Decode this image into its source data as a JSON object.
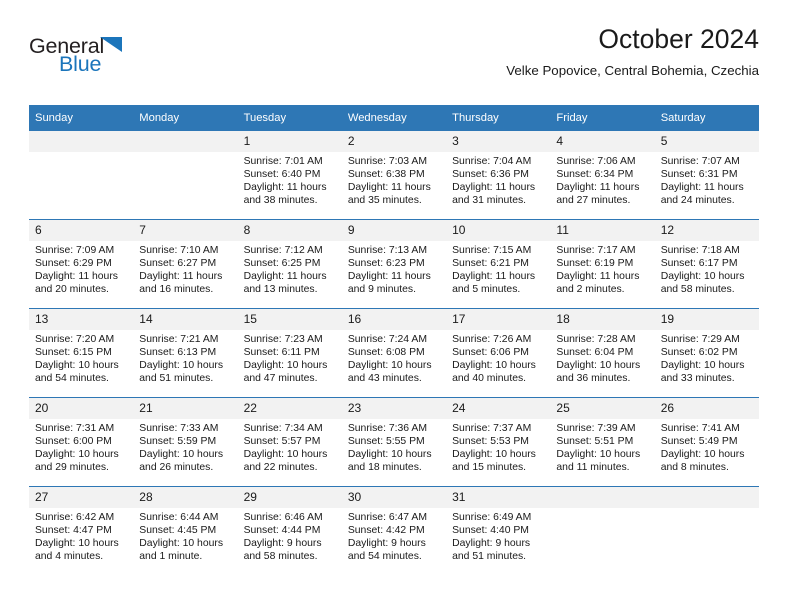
{
  "logo": {
    "text_primary": "General",
    "text_secondary": "Blue",
    "color_primary": "#231f20",
    "color_secondary": "#1b75bb",
    "triangle_icon": "triangle-icon"
  },
  "header": {
    "title": "October 2024",
    "subtitle": "Velke Popovice, Central Bohemia, Czechia"
  },
  "theme": {
    "header_blue": "#2e77b5",
    "daynum_gray": "#f2f2f2",
    "text": "#1a1a1a"
  },
  "calendar": {
    "weekday_headers": [
      "Sunday",
      "Monday",
      "Tuesday",
      "Wednesday",
      "Thursday",
      "Friday",
      "Saturday"
    ],
    "weeks": [
      [
        {
          "day": "",
          "blank": true
        },
        {
          "day": "",
          "blank": true
        },
        {
          "day": "1",
          "sunrise": "Sunrise: 7:01 AM",
          "sunset": "Sunset: 6:40 PM",
          "daylight": "Daylight: 11 hours and 38 minutes."
        },
        {
          "day": "2",
          "sunrise": "Sunrise: 7:03 AM",
          "sunset": "Sunset: 6:38 PM",
          "daylight": "Daylight: 11 hours and 35 minutes."
        },
        {
          "day": "3",
          "sunrise": "Sunrise: 7:04 AM",
          "sunset": "Sunset: 6:36 PM",
          "daylight": "Daylight: 11 hours and 31 minutes."
        },
        {
          "day": "4",
          "sunrise": "Sunrise: 7:06 AM",
          "sunset": "Sunset: 6:34 PM",
          "daylight": "Daylight: 11 hours and 27 minutes."
        },
        {
          "day": "5",
          "sunrise": "Sunrise: 7:07 AM",
          "sunset": "Sunset: 6:31 PM",
          "daylight": "Daylight: 11 hours and 24 minutes."
        }
      ],
      [
        {
          "day": "6",
          "sunrise": "Sunrise: 7:09 AM",
          "sunset": "Sunset: 6:29 PM",
          "daylight": "Daylight: 11 hours and 20 minutes."
        },
        {
          "day": "7",
          "sunrise": "Sunrise: 7:10 AM",
          "sunset": "Sunset: 6:27 PM",
          "daylight": "Daylight: 11 hours and 16 minutes."
        },
        {
          "day": "8",
          "sunrise": "Sunrise: 7:12 AM",
          "sunset": "Sunset: 6:25 PM",
          "daylight": "Daylight: 11 hours and 13 minutes."
        },
        {
          "day": "9",
          "sunrise": "Sunrise: 7:13 AM",
          "sunset": "Sunset: 6:23 PM",
          "daylight": "Daylight: 11 hours and 9 minutes."
        },
        {
          "day": "10",
          "sunrise": "Sunrise: 7:15 AM",
          "sunset": "Sunset: 6:21 PM",
          "daylight": "Daylight: 11 hours and 5 minutes."
        },
        {
          "day": "11",
          "sunrise": "Sunrise: 7:17 AM",
          "sunset": "Sunset: 6:19 PM",
          "daylight": "Daylight: 11 hours and 2 minutes."
        },
        {
          "day": "12",
          "sunrise": "Sunrise: 7:18 AM",
          "sunset": "Sunset: 6:17 PM",
          "daylight": "Daylight: 10 hours and 58 minutes."
        }
      ],
      [
        {
          "day": "13",
          "sunrise": "Sunrise: 7:20 AM",
          "sunset": "Sunset: 6:15 PM",
          "daylight": "Daylight: 10 hours and 54 minutes."
        },
        {
          "day": "14",
          "sunrise": "Sunrise: 7:21 AM",
          "sunset": "Sunset: 6:13 PM",
          "daylight": "Daylight: 10 hours and 51 minutes."
        },
        {
          "day": "15",
          "sunrise": "Sunrise: 7:23 AM",
          "sunset": "Sunset: 6:11 PM",
          "daylight": "Daylight: 10 hours and 47 minutes."
        },
        {
          "day": "16",
          "sunrise": "Sunrise: 7:24 AM",
          "sunset": "Sunset: 6:08 PM",
          "daylight": "Daylight: 10 hours and 43 minutes."
        },
        {
          "day": "17",
          "sunrise": "Sunrise: 7:26 AM",
          "sunset": "Sunset: 6:06 PM",
          "daylight": "Daylight: 10 hours and 40 minutes."
        },
        {
          "day": "18",
          "sunrise": "Sunrise: 7:28 AM",
          "sunset": "Sunset: 6:04 PM",
          "daylight": "Daylight: 10 hours and 36 minutes."
        },
        {
          "day": "19",
          "sunrise": "Sunrise: 7:29 AM",
          "sunset": "Sunset: 6:02 PM",
          "daylight": "Daylight: 10 hours and 33 minutes."
        }
      ],
      [
        {
          "day": "20",
          "sunrise": "Sunrise: 7:31 AM",
          "sunset": "Sunset: 6:00 PM",
          "daylight": "Daylight: 10 hours and 29 minutes."
        },
        {
          "day": "21",
          "sunrise": "Sunrise: 7:33 AM",
          "sunset": "Sunset: 5:59 PM",
          "daylight": "Daylight: 10 hours and 26 minutes."
        },
        {
          "day": "22",
          "sunrise": "Sunrise: 7:34 AM",
          "sunset": "Sunset: 5:57 PM",
          "daylight": "Daylight: 10 hours and 22 minutes."
        },
        {
          "day": "23",
          "sunrise": "Sunrise: 7:36 AM",
          "sunset": "Sunset: 5:55 PM",
          "daylight": "Daylight: 10 hours and 18 minutes."
        },
        {
          "day": "24",
          "sunrise": "Sunrise: 7:37 AM",
          "sunset": "Sunset: 5:53 PM",
          "daylight": "Daylight: 10 hours and 15 minutes."
        },
        {
          "day": "25",
          "sunrise": "Sunrise: 7:39 AM",
          "sunset": "Sunset: 5:51 PM",
          "daylight": "Daylight: 10 hours and 11 minutes."
        },
        {
          "day": "26",
          "sunrise": "Sunrise: 7:41 AM",
          "sunset": "Sunset: 5:49 PM",
          "daylight": "Daylight: 10 hours and 8 minutes."
        }
      ],
      [
        {
          "day": "27",
          "sunrise": "Sunrise: 6:42 AM",
          "sunset": "Sunset: 4:47 PM",
          "daylight": "Daylight: 10 hours and 4 minutes."
        },
        {
          "day": "28",
          "sunrise": "Sunrise: 6:44 AM",
          "sunset": "Sunset: 4:45 PM",
          "daylight": "Daylight: 10 hours and 1 minute."
        },
        {
          "day": "29",
          "sunrise": "Sunrise: 6:46 AM",
          "sunset": "Sunset: 4:44 PM",
          "daylight": "Daylight: 9 hours and 58 minutes."
        },
        {
          "day": "30",
          "sunrise": "Sunrise: 6:47 AM",
          "sunset": "Sunset: 4:42 PM",
          "daylight": "Daylight: 9 hours and 54 minutes."
        },
        {
          "day": "31",
          "sunrise": "Sunrise: 6:49 AM",
          "sunset": "Sunset: 4:40 PM",
          "daylight": "Daylight: 9 hours and 51 minutes."
        },
        {
          "day": "",
          "blank": true
        },
        {
          "day": "",
          "blank": true
        }
      ]
    ]
  }
}
